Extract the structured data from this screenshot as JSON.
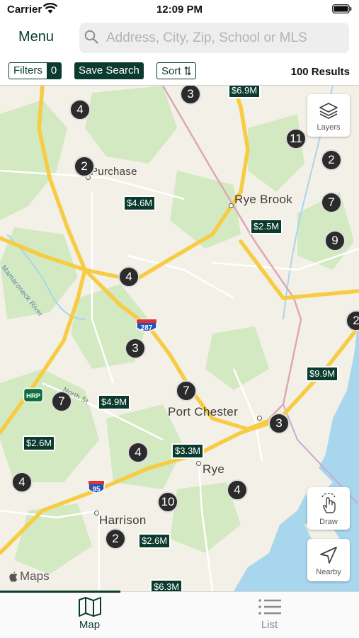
{
  "status_bar": {
    "carrier": "Carrier",
    "time": "12:09 PM"
  },
  "header": {
    "menu_label": "Menu",
    "search_placeholder": "Address, City, Zip, School or MLS",
    "search_value": ""
  },
  "toolbar": {
    "filters_label": "Filters",
    "filters_count": "0",
    "save_search_label": "Save Search",
    "sort_label": "Sort",
    "results_count": "100 Results"
  },
  "map": {
    "clusters": [
      "4",
      "3",
      "2",
      "11",
      "2",
      "7",
      "9",
      "4",
      "3",
      "2",
      "7",
      "7",
      "3",
      "4",
      "4",
      "10",
      "4",
      "2"
    ],
    "price_tags": [
      "$6.9M",
      "$4.6M",
      "$2.5M",
      "$9.9M",
      "$4.9M",
      "$2.6M",
      "$3.3M",
      "$2.6M",
      "$6.3M"
    ],
    "places": {
      "purchase": "Purchase",
      "rye_brook": "Rye Brook",
      "port_chester": "Port Chester",
      "rye": "Rye",
      "harrison": "Harrison",
      "mamaroneck_river": "Mamaroneck River",
      "north_st": "North St"
    },
    "shields": {
      "i287": "287",
      "hrp": "HRP",
      "i95": "95"
    },
    "controls": {
      "layers_label": "Layers",
      "draw_label": "Draw",
      "nearby_label": "Nearby"
    },
    "attribution": "Maps",
    "colors": {
      "land": "#f3f0e7",
      "park": "#d3e9c2",
      "water": "#a8d6ec",
      "highway": "#f7cc45",
      "pin": "#0b3b2e"
    }
  },
  "tabs": [
    {
      "label": "Map",
      "icon": "map-icon",
      "active": true
    },
    {
      "label": "List",
      "icon": "list-icon",
      "active": false
    }
  ]
}
